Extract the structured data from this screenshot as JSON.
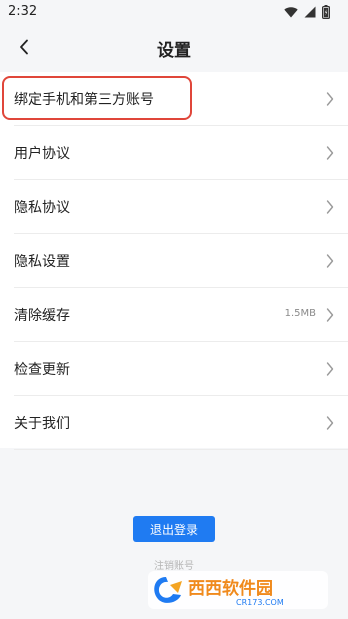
{
  "status_bar": {
    "time": "2:32",
    "icons": [
      "wifi-icon",
      "signal-icon",
      "battery-icon"
    ]
  },
  "header": {
    "back_icon": "chevron-left-icon",
    "title": "设置"
  },
  "settings": {
    "items": [
      {
        "label": "绑定手机和第三方账号",
        "value": "",
        "highlighted": true
      },
      {
        "label": "用户协议",
        "value": ""
      },
      {
        "label": "隐私协议",
        "value": ""
      },
      {
        "label": "隐私设置",
        "value": ""
      },
      {
        "label": "清除缓存",
        "value": "1.5MB"
      },
      {
        "label": "检查更新",
        "value": ""
      },
      {
        "label": "关于我们",
        "value": ""
      }
    ]
  },
  "footer": {
    "logout_label": "退出登录",
    "cancel_account_label": "注销账号"
  },
  "watermark": {
    "brand": "西西软件园",
    "url": "CR173.COM"
  },
  "colors": {
    "accent": "#1f7bf2",
    "highlight": "#e0463a",
    "background": "#f5f6f8"
  }
}
